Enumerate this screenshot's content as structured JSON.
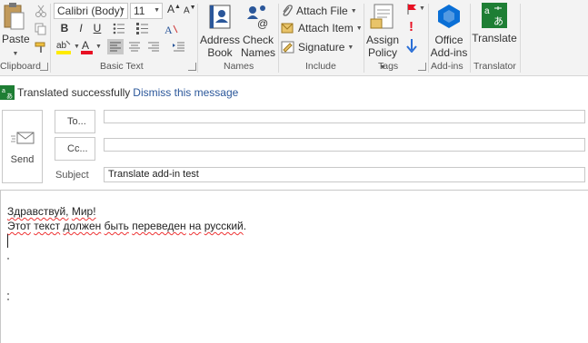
{
  "ribbon": {
    "clipboard": {
      "paste_label": "Paste",
      "group_label": "Clipboard"
    },
    "basic_text": {
      "font_name": "Calibri (Body)",
      "font_size": "11",
      "group_label": "Basic Text",
      "bold": "B",
      "italic": "I",
      "underline": "U"
    },
    "names": {
      "address_book": [
        "Address",
        "Book"
      ],
      "check_names": [
        "Check",
        "Names"
      ],
      "group_label": "Names"
    },
    "include": {
      "attach_file": "Attach File",
      "attach_item": "Attach Item",
      "signature": "Signature",
      "group_label": "Include"
    },
    "tags": {
      "assign_policy": [
        "Assign",
        "Policy"
      ],
      "group_label": "Tags",
      "importance_high": "!"
    },
    "addins": {
      "office_addins": [
        "Office",
        "Add-ins"
      ],
      "group_label": "Add-ins"
    },
    "translator": {
      "translate": "Translate",
      "group_label": "Translator"
    }
  },
  "notice": {
    "text": "Translated successfully",
    "link": "Dismiss this message"
  },
  "compose": {
    "send_label": "Send",
    "to_label": "To...",
    "cc_label": "Cc...",
    "to_value": "",
    "cc_value": "",
    "subject_label": "Subject",
    "subject_value": "Translate add-in test"
  },
  "message": {
    "greeting_word1": "Здравствуй,",
    "greeting_word2": "Мир!",
    "line2_a": "Этот",
    "line2_b": "текст",
    "line2_c": "должен",
    "line2_d": "быть",
    "line2_e": "переведен",
    "line2_f": "на",
    "line2_g": "русский",
    "line2_end": "."
  },
  "colors": {
    "accent": "#2b579a",
    "translator_green": "#1e7e34",
    "office_blue": "#0a6fd6",
    "font_color_red": "#e81123",
    "highlight_yellow": "#ffeb00"
  }
}
